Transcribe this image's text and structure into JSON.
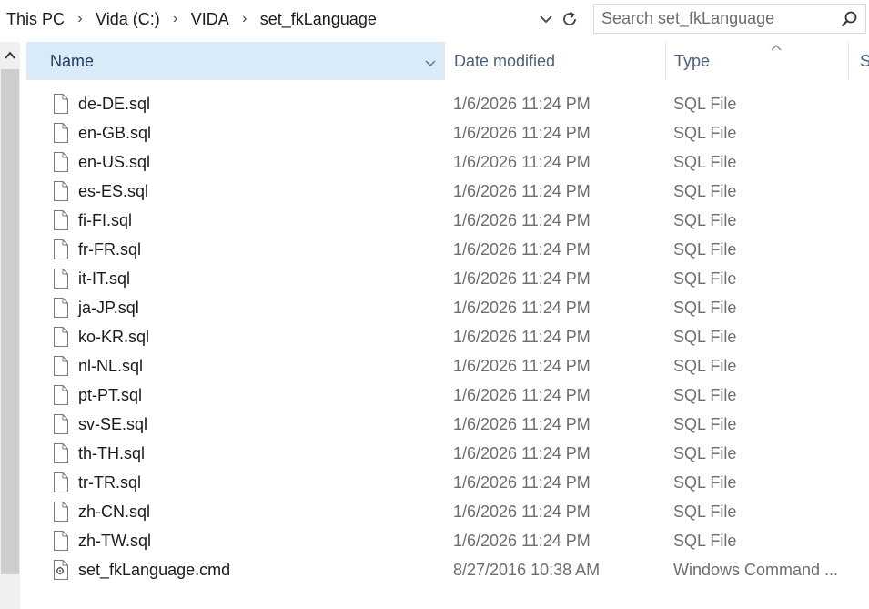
{
  "address": {
    "crumbs": [
      "This PC",
      "Vida (C:)",
      "VIDA",
      "set_fkLanguage"
    ],
    "separator": "›"
  },
  "search": {
    "placeholder": "Search set_fkLanguage",
    "value": ""
  },
  "columns": {
    "name": "Name",
    "date": "Date modified",
    "type": "Type",
    "size": "Si"
  },
  "files": [
    {
      "name": "de-DE.sql",
      "date": "1/6/2026 11:24 PM",
      "type": "SQL File",
      "icon": "document-icon"
    },
    {
      "name": "en-GB.sql",
      "date": "1/6/2026 11:24 PM",
      "type": "SQL File",
      "icon": "document-icon"
    },
    {
      "name": "en-US.sql",
      "date": "1/6/2026 11:24 PM",
      "type": "SQL File",
      "icon": "document-icon"
    },
    {
      "name": "es-ES.sql",
      "date": "1/6/2026 11:24 PM",
      "type": "SQL File",
      "icon": "document-icon"
    },
    {
      "name": "fi-FI.sql",
      "date": "1/6/2026 11:24 PM",
      "type": "SQL File",
      "icon": "document-icon"
    },
    {
      "name": "fr-FR.sql",
      "date": "1/6/2026 11:24 PM",
      "type": "SQL File",
      "icon": "document-icon"
    },
    {
      "name": "it-IT.sql",
      "date": "1/6/2026 11:24 PM",
      "type": "SQL File",
      "icon": "document-icon"
    },
    {
      "name": "ja-JP.sql",
      "date": "1/6/2026 11:24 PM",
      "type": "SQL File",
      "icon": "document-icon"
    },
    {
      "name": "ko-KR.sql",
      "date": "1/6/2026 11:24 PM",
      "type": "SQL File",
      "icon": "document-icon"
    },
    {
      "name": "nl-NL.sql",
      "date": "1/6/2026 11:24 PM",
      "type": "SQL File",
      "icon": "document-icon"
    },
    {
      "name": "pt-PT.sql",
      "date": "1/6/2026 11:24 PM",
      "type": "SQL File",
      "icon": "document-icon"
    },
    {
      "name": "sv-SE.sql",
      "date": "1/6/2026 11:24 PM",
      "type": "SQL File",
      "icon": "document-icon"
    },
    {
      "name": "th-TH.sql",
      "date": "1/6/2026 11:24 PM",
      "type": "SQL File",
      "icon": "document-icon"
    },
    {
      "name": "tr-TR.sql",
      "date": "1/6/2026 11:24 PM",
      "type": "SQL File",
      "icon": "document-icon"
    },
    {
      "name": "zh-CN.sql",
      "date": "1/6/2026 11:24 PM",
      "type": "SQL File",
      "icon": "document-icon"
    },
    {
      "name": "zh-TW.sql",
      "date": "1/6/2026 11:24 PM",
      "type": "SQL File",
      "icon": "document-icon"
    },
    {
      "name": "set_fkLanguage.cmd",
      "date": "8/27/2016 10:38 AM",
      "type": "Windows Command ...",
      "icon": "command-script-icon"
    }
  ],
  "colors": {
    "selected_header": "#d9ebf9",
    "secondary_text": "#6d6d6d",
    "scroll_thumb": "#cdcdcd"
  }
}
